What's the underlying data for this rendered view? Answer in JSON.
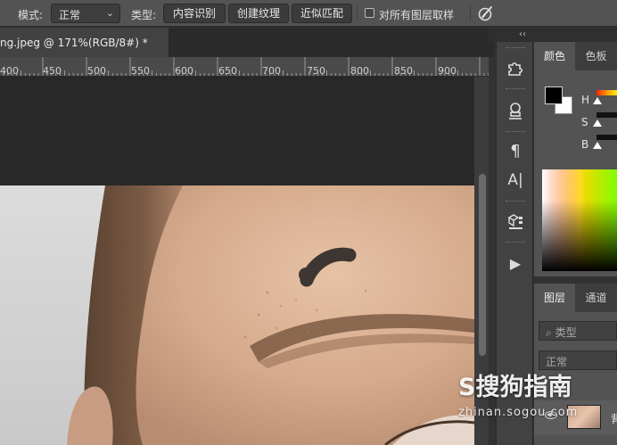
{
  "options_bar": {
    "mode_label": "模式:",
    "mode_value": "正常",
    "type_label": "类型:",
    "type_buttons": [
      "内容识别",
      "创建纹理",
      "近似匹配"
    ],
    "sample_all_layers_label": "对所有图层取样"
  },
  "document": {
    "tab_title": "ng.jpeg @ 171%(RGB/8#) *",
    "close_symbol": "×"
  },
  "ruler": {
    "tick_labels": [
      "400",
      "450",
      "500",
      "550",
      "600",
      "650",
      "700",
      "750",
      "800",
      "850",
      "900"
    ]
  },
  "panel_strip": {
    "collapse_symbol": "‹‹",
    "tools": [
      "puzzle-icon",
      "stamp-brush-icon",
      "paragraph-icon",
      "character-icon",
      "3d-layers-icon",
      "play-icon"
    ],
    "paragraph_glyph": "¶",
    "character_glyph": "A|",
    "play_glyph": "▶"
  },
  "color_panel": {
    "tabs": [
      "颜色",
      "色板"
    ],
    "active_tab": "颜色",
    "foreground_color": "#000000",
    "background_color": "#ffffff",
    "hsb_labels": [
      "H",
      "S",
      "B"
    ]
  },
  "layers_panel": {
    "tabs": [
      "图层",
      "通道"
    ],
    "active_tab": "图层",
    "filter_placeholder": "类型",
    "filter_icon": "search-icon",
    "blend_mode": "正常",
    "layer_name": "背"
  },
  "watermark": {
    "logo_text": "S搜狗指南",
    "url": "zhinan.sogou.com"
  },
  "colors": {
    "options_bar_bg": "#535353",
    "canvas_bg": "#282828",
    "panel_bg": "#535353"
  }
}
